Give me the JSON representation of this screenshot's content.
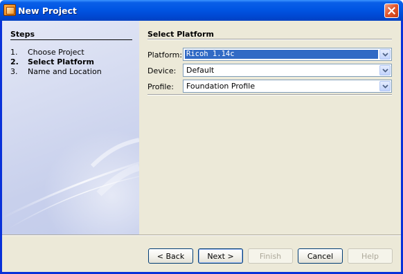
{
  "window": {
    "title": "New Project"
  },
  "steps": {
    "heading": "Steps",
    "items": [
      {
        "number": "1.",
        "label": "Choose Project",
        "current": false
      },
      {
        "number": "2.",
        "label": "Select Platform",
        "current": true
      },
      {
        "number": "3.",
        "label": "Name and Location",
        "current": false
      }
    ]
  },
  "panel": {
    "title": "Select Platform",
    "fields": [
      {
        "label": "Platform:",
        "value": "Ricoh 1.14c",
        "selected": true
      },
      {
        "label": "Device:",
        "value": "Default",
        "selected": false
      },
      {
        "label": "Profile:",
        "value": "Foundation Profile",
        "selected": false
      }
    ]
  },
  "buttons": {
    "back": "< Back",
    "next": "Next >",
    "finish": "Finish",
    "cancel": "Cancel",
    "help": "Help"
  },
  "icons": {
    "app": "project-icon",
    "close": "close-icon",
    "dropdown": "chevron-down-icon"
  },
  "colors": {
    "titlebar": "#0055e3",
    "selection": "#316ac5",
    "close": "#e2582f"
  }
}
